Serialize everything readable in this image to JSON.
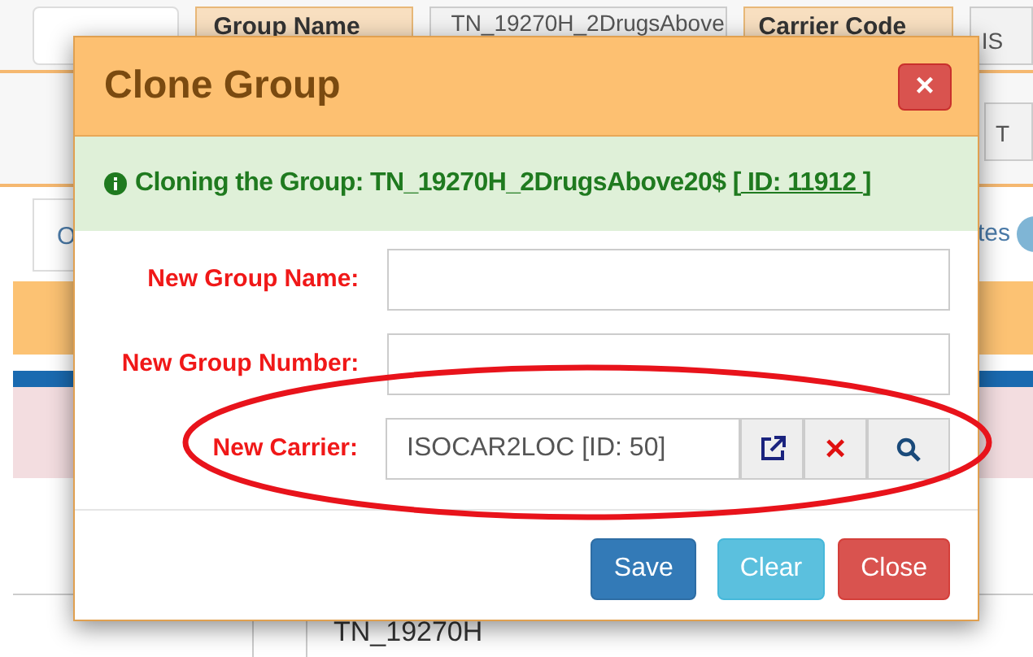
{
  "background": {
    "header_label_1": "Group Name",
    "header_value_1": "TN_19270H_2DrugsAbove",
    "header_label_2": "Carrier Code",
    "header_value_2": "IS",
    "row_2_value": "T",
    "tab_left": "O",
    "tab_right": "tes",
    "table_cell": "TN_19270H"
  },
  "dialog": {
    "title": "Clone Group",
    "close_label": "×",
    "alert": {
      "text": "Cloning the Group: TN_19270H_2DrugsAbove20$",
      "link_open": "[",
      "link": " ID: 11912 ",
      "link_close": "]"
    },
    "fields": [
      {
        "label": "New Group Name:",
        "kind": "text"
      },
      {
        "label": "New Group Number:",
        "kind": "text"
      },
      {
        "label": "New Carrier:",
        "value": "ISOCAR2LOC [ID: 50]",
        "kind": "lookup",
        "annotated": true
      }
    ],
    "lookup_clear_label": "×",
    "buttons": [
      {
        "label": "Save",
        "kind": "primary"
      },
      {
        "label": "Clear",
        "kind": "info"
      },
      {
        "label": "Close",
        "kind": "danger"
      }
    ]
  }
}
